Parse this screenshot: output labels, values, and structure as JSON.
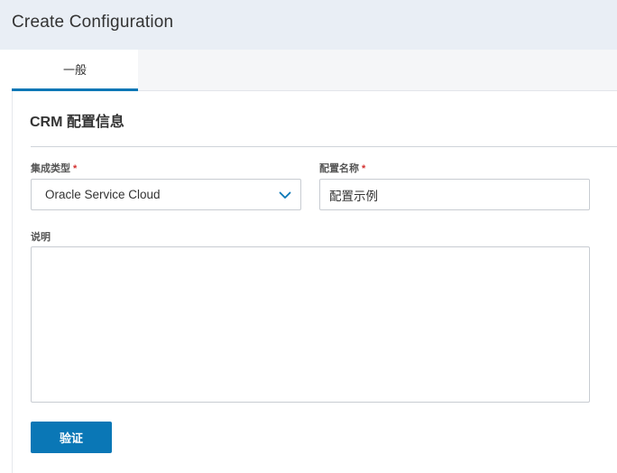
{
  "page": {
    "title": "Create Configuration"
  },
  "tabs": [
    {
      "label": "一般",
      "active": true
    }
  ],
  "section": {
    "title": "CRM 配置信息"
  },
  "form": {
    "integration_type": {
      "label": "集成类型",
      "required_mark": "*",
      "value": "Oracle Service Cloud",
      "icon": "chevron-down-icon"
    },
    "config_name": {
      "label": "配置名称",
      "required_mark": "*",
      "value": "配置示例"
    },
    "description": {
      "label": "说明",
      "value": ""
    }
  },
  "actions": {
    "validate_label": "验证"
  },
  "colors": {
    "accent": "#0a77b6",
    "required": "#d3302f",
    "header_bg": "#e9eef5"
  }
}
